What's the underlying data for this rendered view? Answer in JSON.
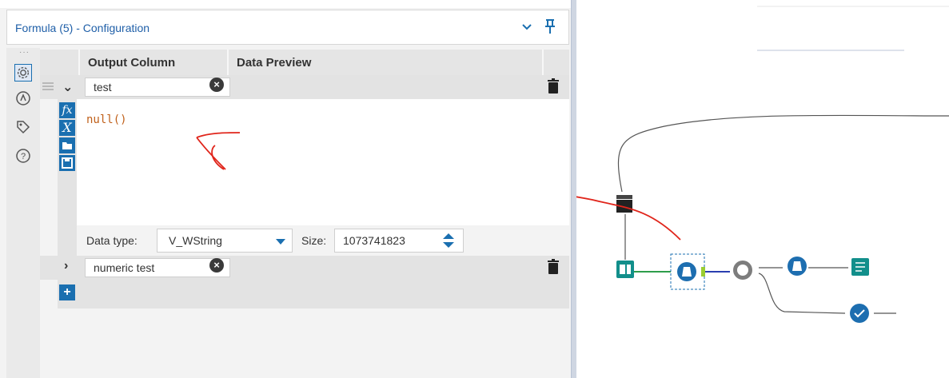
{
  "panel": {
    "title": "Formula (5) - Configuration"
  },
  "sidebar": {
    "items": [
      {
        "icon": "gear-icon"
      },
      {
        "icon": "annotation-icon"
      },
      {
        "icon": "tag-icon"
      },
      {
        "icon": "help-icon"
      }
    ]
  },
  "grid": {
    "columns": [
      "Output Column",
      "Data Preview"
    ],
    "rows": [
      {
        "name": "test",
        "expanded": true
      },
      {
        "name": "numeric test",
        "expanded": false
      }
    ]
  },
  "editor": {
    "expression": "null()",
    "tools": [
      "fx",
      "X",
      "folder-icon",
      "save-icon"
    ]
  },
  "datatype": {
    "label": "Data type:",
    "value": "V_WString",
    "size_label": "Size:",
    "size_value": "1073741823"
  },
  "colors": {
    "accent": "#1a6fb0",
    "workflow_teal": "#128f8b",
    "annotation_red": "#e0251b"
  }
}
